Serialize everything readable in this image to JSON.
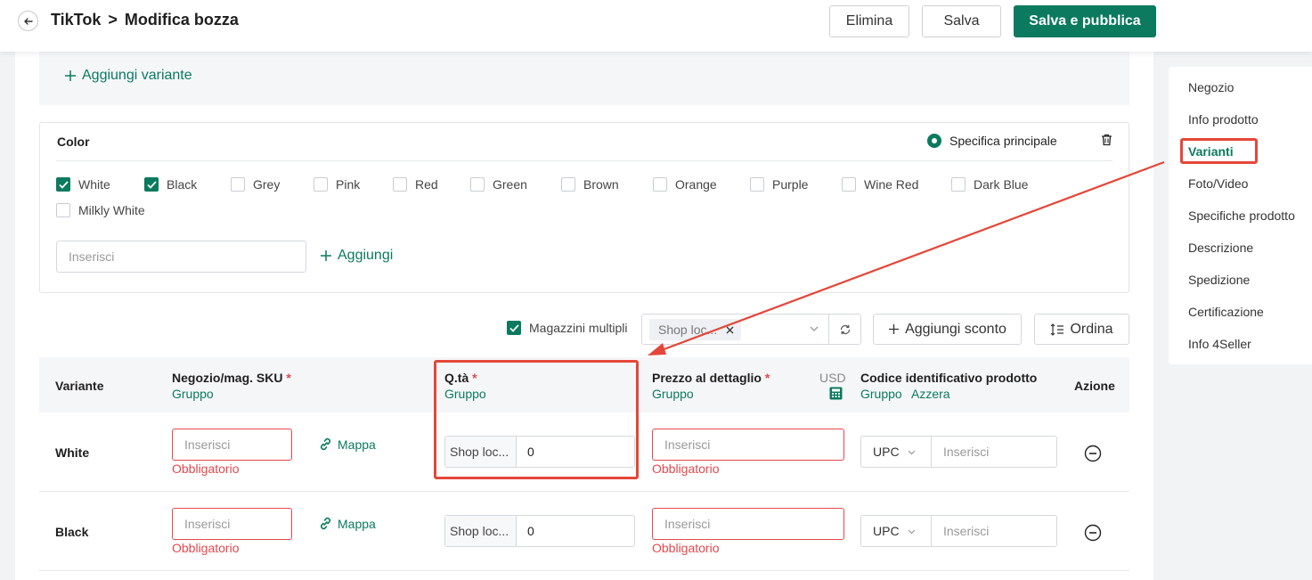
{
  "header": {
    "breadcrumb_app": "TikTok",
    "breadcrumb_sep": ">",
    "page_title": "Modifica bozza",
    "delete_label": "Elimina",
    "save_label": "Salva",
    "publish_label": "Salva e pubblica"
  },
  "variant": {
    "add_variant_label": "Aggiungi variante",
    "color_title": "Color",
    "main_spec_label": "Specifica principale",
    "options": [
      {
        "label": "White",
        "checked": true
      },
      {
        "label": "Black",
        "checked": true
      },
      {
        "label": "Grey",
        "checked": false
      },
      {
        "label": "Pink",
        "checked": false
      },
      {
        "label": "Red",
        "checked": false
      },
      {
        "label": "Green",
        "checked": false
      },
      {
        "label": "Brown",
        "checked": false
      },
      {
        "label": "Orange",
        "checked": false
      },
      {
        "label": "Purple",
        "checked": false
      },
      {
        "label": "Wine Red",
        "checked": false
      },
      {
        "label": "Dark Blue",
        "checked": false
      },
      {
        "label": "Milkly White",
        "checked": false
      }
    ],
    "input_placeholder": "Inserisci",
    "add_label": "Aggiungi"
  },
  "toolbar": {
    "multi_warehouse_label": "Magazzini multipli",
    "multi_warehouse_checked": true,
    "shop_tag": "Shop loc...",
    "add_discount_label": "Aggiungi sconto",
    "order_label": "Ordina"
  },
  "table": {
    "col_variant": "Variante",
    "col_sku": "Negozio/mag. SKU",
    "col_qty": "Q.tà",
    "col_price": "Prezzo al dettaglio",
    "col_price_currency": "USD",
    "col_code": "Codice identificativo prodotto",
    "col_action": "Azione",
    "required_mark": "*",
    "group_label": "Gruppo",
    "reset_label": "Azzera",
    "rows": [
      {
        "name": "White",
        "sku_placeholder": "Inserisci",
        "sku_error": "Obbligatorio",
        "map_label": "Mappa",
        "qty_shop": "Shop loc...",
        "qty_value": "0",
        "price_placeholder": "Inserisci",
        "price_error": "Obbligatorio",
        "code_type": "UPC",
        "code_placeholder": "Inserisci"
      },
      {
        "name": "Black",
        "sku_placeholder": "Inserisci",
        "sku_error": "Obbligatorio",
        "map_label": "Mappa",
        "qty_shop": "Shop loc...",
        "qty_value": "0",
        "price_placeholder": "Inserisci",
        "price_error": "Obbligatorio",
        "code_type": "UPC",
        "code_placeholder": "Inserisci"
      }
    ]
  },
  "rightnav": {
    "items": [
      "Negozio",
      "Info prodotto",
      "Varianti",
      "Foto/Video",
      "Specifiche prodotto",
      "Descrizione",
      "Spedizione",
      "Certificazione",
      "Info 4Seller"
    ],
    "active_index": 2
  },
  "colors": {
    "brand": "#0b7a5f",
    "error": "#e5484d",
    "annotation": "#e4473a"
  }
}
